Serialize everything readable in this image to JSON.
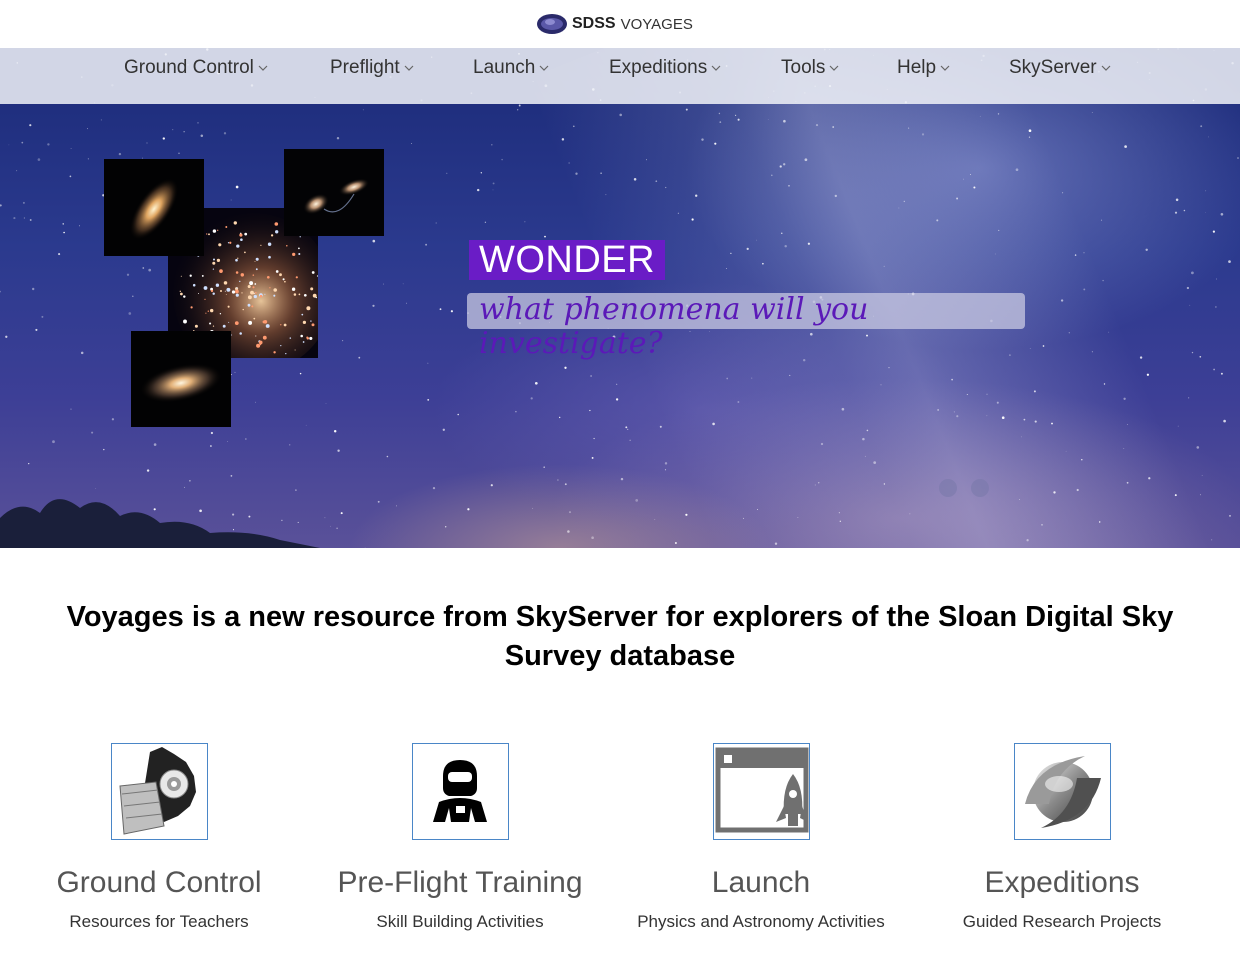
{
  "brand": {
    "sdss": "SDSS",
    "voyages": "VOYAGES"
  },
  "nav": {
    "items": [
      {
        "label": "Ground Control"
      },
      {
        "label": "Preflight"
      },
      {
        "label": "Launch"
      },
      {
        "label": "Expeditions"
      },
      {
        "label": "Tools"
      },
      {
        "label": "Help"
      },
      {
        "label": "SkyServer"
      }
    ]
  },
  "hero": {
    "heading": "WONDER",
    "tagline": "what phenomena will you investigate?",
    "accent_color": "#6a1cc6"
  },
  "headline": "Voyages is a new resource from SkyServer for explorers of the Sloan Digital Sky Survey database",
  "cards": [
    {
      "title": "Ground Control",
      "subtitle": "Resources for Teachers",
      "icon": "telescope-icon"
    },
    {
      "title": "Pre-Flight Training",
      "subtitle": "Skill Building Activities",
      "icon": "astronaut-icon"
    },
    {
      "title": "Launch",
      "subtitle": "Physics and Astronomy Activities",
      "icon": "rocket-window-icon"
    },
    {
      "title": "Expeditions",
      "subtitle": "Guided Research Projects",
      "icon": "swirl-logo-icon"
    }
  ]
}
